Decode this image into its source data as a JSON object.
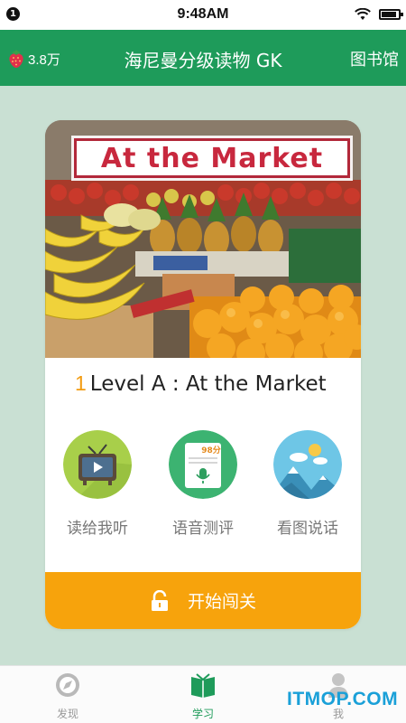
{
  "status_bar": {
    "notification_count": "1",
    "time": "9:48AM",
    "icons": [
      "wifi-icon",
      "battery-icon"
    ]
  },
  "nav": {
    "count": "3.8万",
    "count_icon": "strawberry-icon",
    "title": "海尼曼分级读物 GK",
    "library": "图书馆"
  },
  "card": {
    "cover_title": "At the Market",
    "book_number": "1",
    "book_title": "Level A : At the Market",
    "features": [
      {
        "label": "读给我听",
        "icon": "tv-icon"
      },
      {
        "label": "语音测评",
        "icon": "speech-score-icon",
        "score_badge": "98分"
      },
      {
        "label": "看图说话",
        "icon": "landscape-icon"
      }
    ],
    "start_button": "开始闯关",
    "start_icon": "unlock-icon"
  },
  "tabs": [
    {
      "label": "发现",
      "icon": "compass-icon",
      "active": false
    },
    {
      "label": "学习",
      "icon": "book-icon",
      "active": true
    },
    {
      "label": "我",
      "icon": "person-icon",
      "active": false
    }
  ],
  "watermark": "ITMOP.COM",
  "colors": {
    "nav_green": "#1e9b5a",
    "background": "#c9e0d3",
    "accent_orange": "#f7a30c",
    "number_orange": "#f39c12",
    "cover_red": "#c8283e"
  }
}
